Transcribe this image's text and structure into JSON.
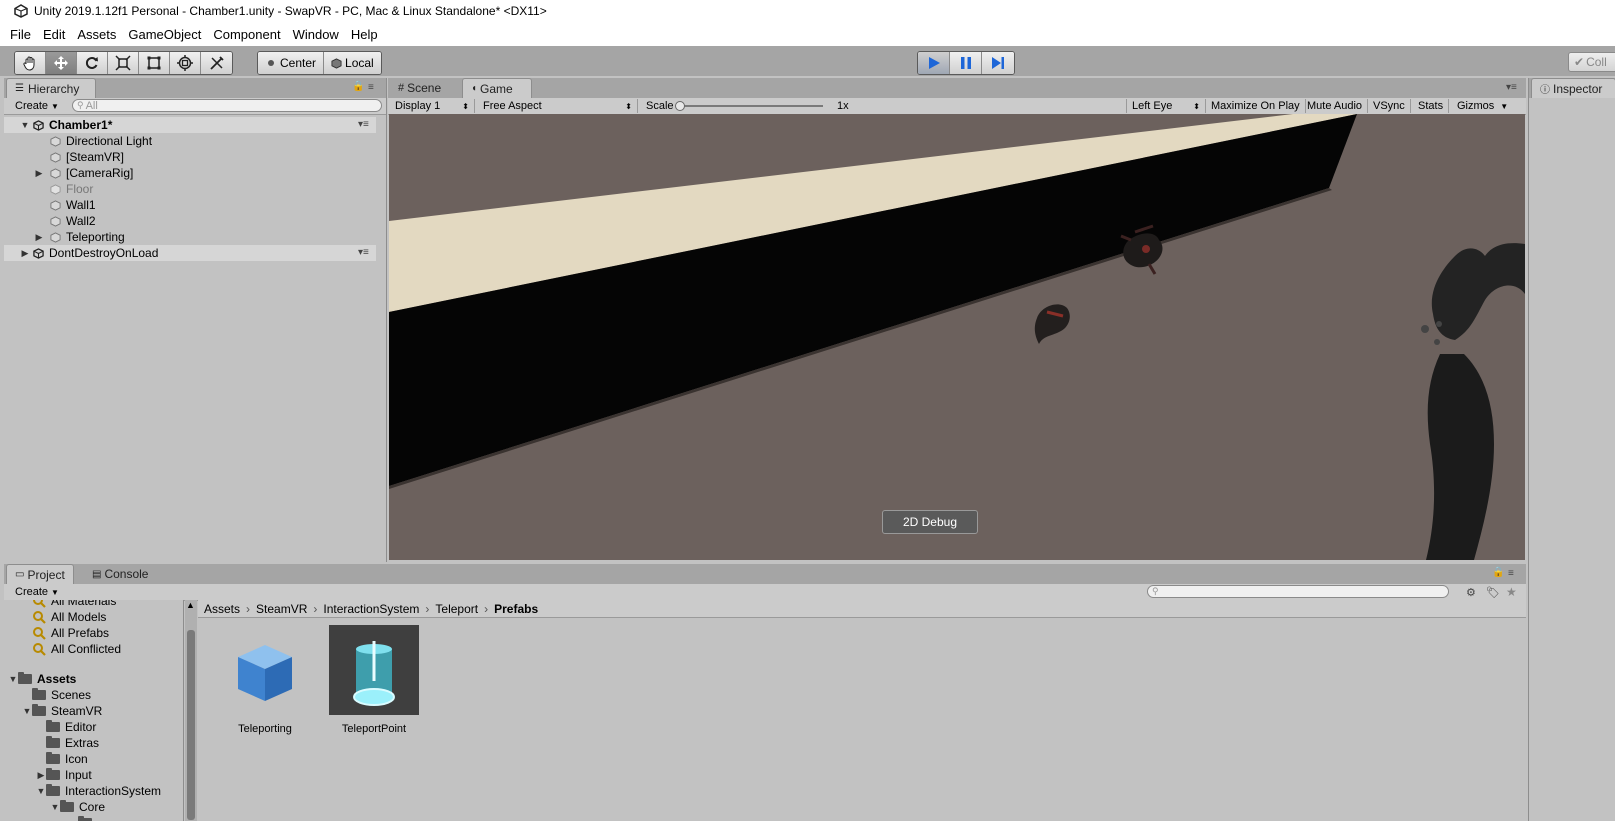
{
  "window": {
    "title": "Unity 2019.1.12f1 Personal - Chamber1.unity - SwapVR - PC, Mac & Linux Standalone* <DX11>"
  },
  "menu": [
    "File",
    "Edit",
    "Assets",
    "GameObject",
    "Component",
    "Window",
    "Help"
  ],
  "toolbar": {
    "tools": [
      "hand-icon",
      "move-icon",
      "rotate-icon",
      "scale-icon",
      "rect-icon",
      "transform-icon",
      "custom-tool-icon"
    ],
    "pivot": "Center",
    "space": "Local",
    "play_state": "playing",
    "collab": "Coll"
  },
  "hierarchy": {
    "tab": "Hierarchy",
    "create": "Create",
    "search_placeholder": "All",
    "scene": "Chamber1*",
    "items": [
      {
        "label": "Directional Light",
        "expandable": false,
        "dimmed": false
      },
      {
        "label": "[SteamVR]",
        "expandable": false,
        "dimmed": false
      },
      {
        "label": "[CameraRig]",
        "expandable": true,
        "dimmed": false
      },
      {
        "label": "Floor",
        "expandable": false,
        "dimmed": true
      },
      {
        "label": "Wall1",
        "expandable": false,
        "dimmed": false
      },
      {
        "label": "Wall2",
        "expandable": false,
        "dimmed": false
      },
      {
        "label": "Teleporting",
        "expandable": true,
        "dimmed": false
      }
    ],
    "dontdestroy": "DontDestroyOnLoad"
  },
  "game_view": {
    "tabs": [
      "Scene",
      "Game"
    ],
    "active_tab": "Game",
    "display": "Display 1",
    "aspect": "Free Aspect",
    "scale_label": "Scale",
    "scale_value": "1x",
    "eye": "Left Eye",
    "toggles": [
      "Maximize On Play",
      "Mute Audio",
      "VSync",
      "Stats"
    ],
    "gizmos": "Gizmos",
    "debug_button": "2D Debug"
  },
  "inspector": {
    "tab": "Inspector"
  },
  "project": {
    "tabs": [
      "Project",
      "Console"
    ],
    "create": "Create",
    "favorites": [
      "All Materials",
      "All Models",
      "All Prefabs",
      "All Conflicted"
    ],
    "tree": [
      {
        "label": "Assets",
        "depth": 0,
        "expanded": true,
        "bold": true
      },
      {
        "label": "Scenes",
        "depth": 1,
        "expanded": null
      },
      {
        "label": "SteamVR",
        "depth": 1,
        "expanded": true
      },
      {
        "label": "Editor",
        "depth": 2,
        "expanded": null
      },
      {
        "label": "Extras",
        "depth": 2,
        "expanded": null
      },
      {
        "label": "Icon",
        "depth": 2,
        "expanded": null
      },
      {
        "label": "Input",
        "depth": 2,
        "expanded": false
      },
      {
        "label": "InteractionSystem",
        "depth": 2,
        "expanded": true
      },
      {
        "label": "Core",
        "depth": 3,
        "expanded": true
      }
    ],
    "breadcrumb": [
      "Assets",
      "SteamVR",
      "InteractionSystem",
      "Teleport",
      "Prefabs"
    ],
    "assets": [
      {
        "label": "Teleporting",
        "icon": "blue-cube-icon"
      },
      {
        "label": "TeleportPoint",
        "icon": "teleport-point-icon"
      }
    ]
  }
}
